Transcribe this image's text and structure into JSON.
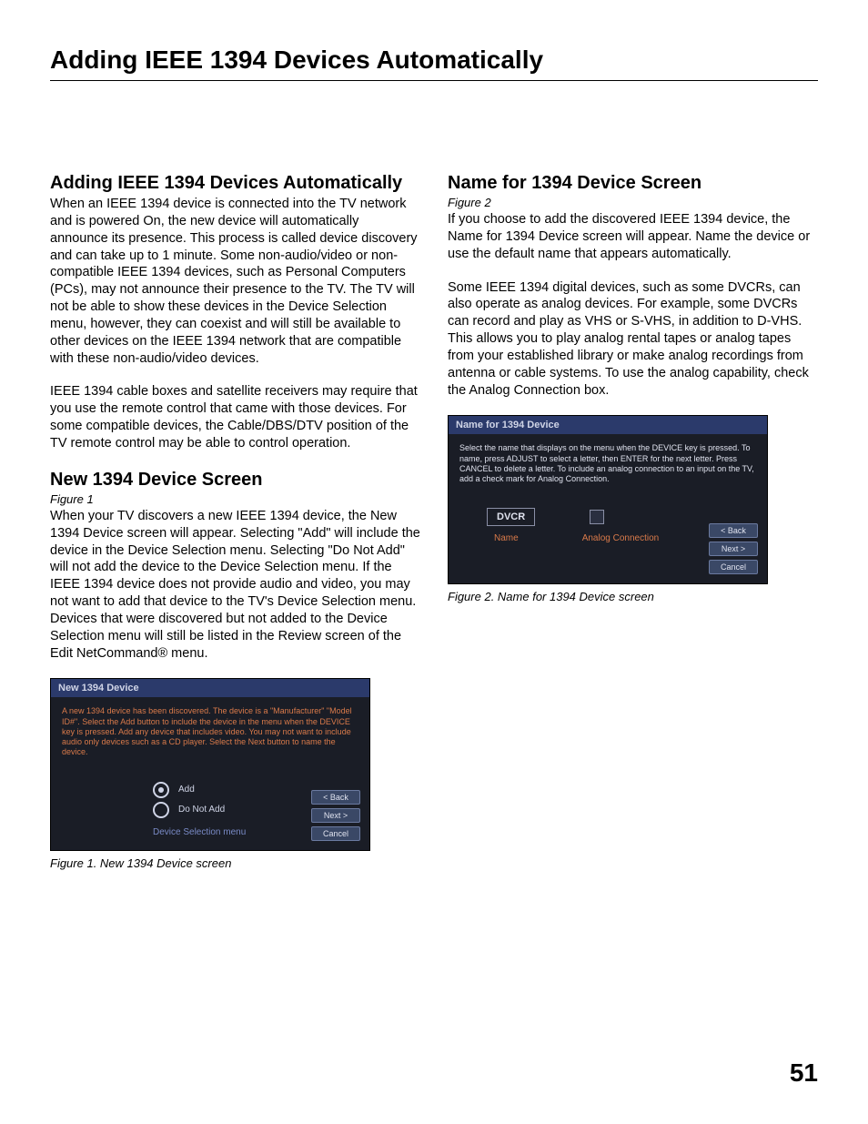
{
  "page_title": "Adding IEEE 1394 Devices Automatically",
  "page_number": "51",
  "left": {
    "h1": "Adding IEEE 1394 Devices Automatically",
    "p1": "When an IEEE 1394 device is connected into the TV network and is powered On, the new device will automatically announce its presence.  This process is called device discovery and can take up to 1 minute.  Some non-audio/video or non-compatible IEEE 1394 devices, such as Personal Computers (PCs), may not announce their presence to the TV.  The TV will not be able to show these devices in the Device Selection menu, however, they can coexist and will still be available to other devices on the IEEE 1394 network that are compatible with these non-audio/video devices.",
    "p2": "IEEE 1394 cable boxes and satellite receivers may require that you use the remote control that came with those devices.  For some compatible devices, the Cable/DBS/DTV position of the TV remote control may be able to control operation.",
    "h2": "New 1394 Device Screen",
    "fig1_ref": "Figure 1",
    "p3": "When your TV discovers a new IEEE 1394 device, the New 1394 Device screen will appear.  Selecting \"Add\" will include the device in the Device Selection menu.  Selecting \"Do Not Add\" will not add the device to the Device Selection menu.  If the IEEE 1394 device does not provide audio and video, you may not want to add that device to the TV's Device Selection menu.  Devices that were discovered but not added to the Device Selection menu will still be listed in the Review screen of the Edit NetCommand® menu.",
    "fig1_caption": "Figure 1. New 1394 Device screen",
    "shot1": {
      "title": "New 1394 Device",
      "instr": "A new 1394 device has been discovered. The device is a \"Manufacturer\" \"Model ID#\". Select the Add button to include the device in the menu when the DEVICE key is pressed.  Add any device that includes video. You may not want to include audio only devices such as a CD player. Select the Next button to name the device.",
      "opt_add": "Add",
      "opt_no": "Do Not Add",
      "link": "Device Selection menu",
      "btn_back": "< Back",
      "btn_next": "Next >",
      "btn_cancel": "Cancel"
    }
  },
  "right": {
    "h1": "Name for 1394 Device Screen",
    "fig2_ref": "Figure 2",
    "p1": "If you choose to add the discovered IEEE 1394 device, the Name for 1394 Device screen will appear.  Name the device or use the default name that appears automatically.",
    "p2": "Some IEEE 1394 digital devices, such as some DVCRs, can also operate as analog devices.  For example, some DVCRs can record and play as VHS or S-VHS, in addition to D-VHS.  This allows you to play analog rental tapes or analog tapes from your established library or make analog recordings from antenna or cable systems.  To use the analog capability, check the Analog Connection box.",
    "fig2_caption": "Figure 2. Name for 1394 Device screen",
    "shot2": {
      "title": "Name for 1394 Device",
      "instr": "Select the name that displays on the menu when the DEVICE key is pressed.  To name, press ADJUST to select a letter, then ENTER for the next letter. Press CANCEL to delete a letter. To include an analog connection to an input on the TV, add a check mark for Analog Connection.",
      "name_value": "DVCR",
      "label_name": "Name",
      "label_analog": "Analog Connection",
      "btn_back": "< Back",
      "btn_next": "Next >",
      "btn_cancel": "Cancel"
    }
  }
}
